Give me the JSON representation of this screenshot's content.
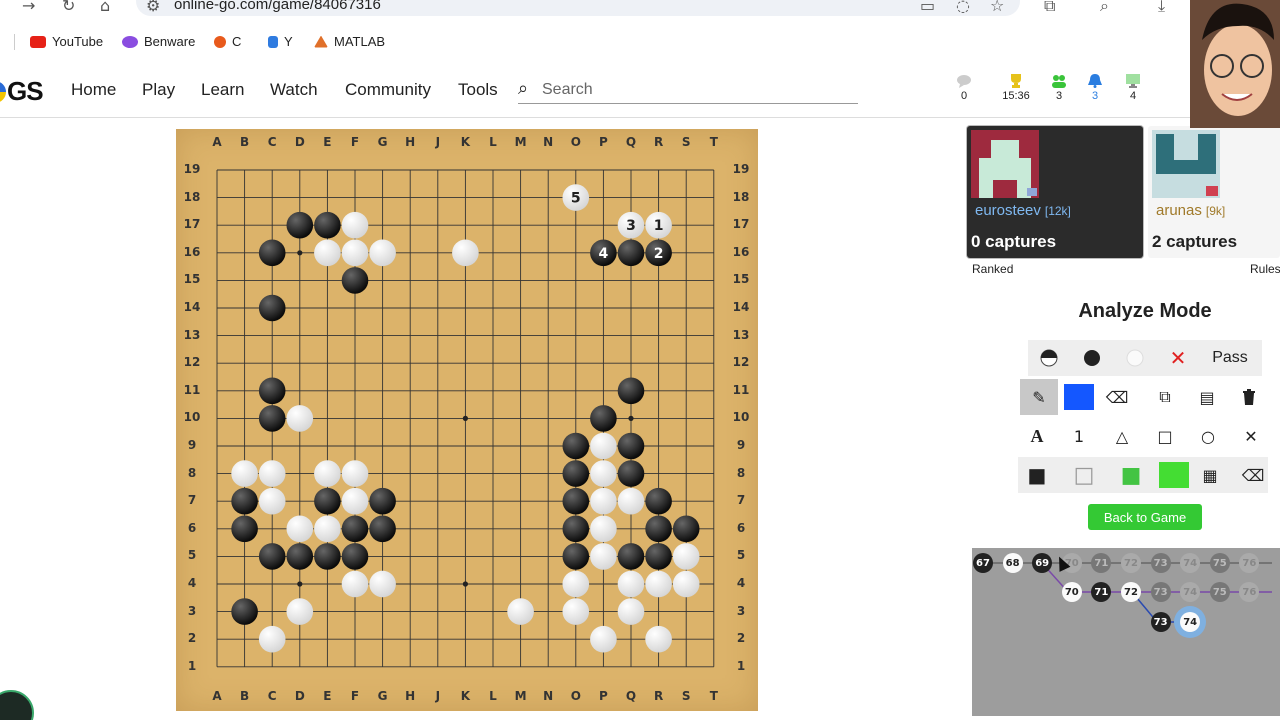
{
  "browser": {
    "url": "online-go.com/game/84067316",
    "bookmarks": [
      {
        "label": "YouTube",
        "color": "#e62117"
      },
      {
        "label": "Benware",
        "color": "#8a4de0"
      },
      {
        "label": "C",
        "color": "#e85a1c"
      },
      {
        "label": "Y",
        "color": "#2f7be0"
      },
      {
        "label": "MATLAB",
        "color": "#e0702a"
      }
    ]
  },
  "nav": {
    "logo": "GS",
    "items": [
      "Home",
      "Play",
      "Learn",
      "Watch",
      "Community",
      "Tools"
    ],
    "search_placeholder": "Search",
    "stats": [
      {
        "icon": "chat-bubble-icon",
        "value": "0",
        "color": "#cccccc"
      },
      {
        "icon": "trophy-icon",
        "value": "15:36",
        "color": "#e6c21a"
      },
      {
        "icon": "group-icon",
        "value": "3",
        "color": "#3ac43a"
      },
      {
        "icon": "bell-icon",
        "value": "3",
        "color": "#2a7de0"
      },
      {
        "icon": "monitor-icon",
        "value": "4",
        "color": "#a0e0a0"
      }
    ]
  },
  "board": {
    "columns": [
      "A",
      "B",
      "C",
      "D",
      "E",
      "F",
      "G",
      "H",
      "J",
      "K",
      "L",
      "M",
      "N",
      "O",
      "P",
      "Q",
      "R",
      "S",
      "T"
    ],
    "rows": [
      "19",
      "18",
      "17",
      "16",
      "15",
      "14",
      "13",
      "12",
      "11",
      "10",
      "9",
      "8",
      "7",
      "6",
      "5",
      "4",
      "3",
      "2",
      "1"
    ],
    "black_stones": [
      "D17",
      "E17",
      "C16",
      "F15",
      "C14",
      "C11",
      "C10",
      "Q11",
      "P10",
      "O9",
      "Q9",
      "O8",
      "Q8",
      "B7",
      "E7",
      "G7",
      "O7",
      "R7",
      "B6",
      "F6",
      "G6",
      "O6",
      "R6",
      "S6",
      "C5",
      "D5",
      "E5",
      "F5",
      "O5",
      "Q5",
      "R5",
      "B3",
      "P16",
      "Q16",
      "R16"
    ],
    "white_stones": [
      "F17",
      "E16",
      "F16",
      "G16",
      "K16",
      "D10",
      "P9",
      "B8",
      "C8",
      "E8",
      "F8",
      "P8",
      "C7",
      "F7",
      "P7",
      "Q7",
      "D6",
      "E6",
      "P6",
      "P5",
      "S5",
      "F4",
      "G4",
      "O4",
      "Q4",
      "R4",
      "S4",
      "D3",
      "M3",
      "O3",
      "Q3",
      "C2",
      "P2",
      "R2",
      "O18",
      "Q17",
      "R17"
    ],
    "labels": [
      {
        "point": "O18",
        "text": "5"
      },
      {
        "point": "Q17",
        "text": "3"
      },
      {
        "point": "R17",
        "text": "1"
      },
      {
        "point": "P16",
        "text": "4"
      },
      {
        "point": "R16",
        "text": "2"
      }
    ],
    "star_points": [
      "D16",
      "K16",
      "Q16",
      "D10",
      "K10",
      "Q10",
      "D4",
      "K4",
      "Q4"
    ]
  },
  "players": [
    {
      "name": "eurosteev",
      "rank": "[12k]",
      "captures": "0 captures",
      "note": "Ranked"
    },
    {
      "name": "arunas",
      "rank": "[9k]",
      "captures": "2 captures",
      "note": "Rules"
    }
  ],
  "analyze": {
    "title": "Analyze Mode",
    "row1": [
      {
        "name": "alternate-stone-icon",
        "glyph": "◐"
      },
      {
        "name": "black-stone-icon",
        "glyph": "●"
      },
      {
        "name": "white-stone-icon",
        "glyph": "●"
      },
      {
        "name": "delete-x-icon",
        "glyph": "✕"
      },
      {
        "name": "pass-button",
        "glyph": "Pass"
      }
    ],
    "row2": [
      {
        "name": "pen-icon",
        "glyph": "✎"
      },
      {
        "name": "color-swatch-blue",
        "glyph": ""
      },
      {
        "name": "eraser-icon",
        "glyph": "⌫"
      },
      {
        "name": "copy-icon",
        "glyph": "⧉"
      },
      {
        "name": "paste-icon",
        "glyph": "▤"
      },
      {
        "name": "trash-icon",
        "glyph": "🗑"
      }
    ],
    "row3": [
      {
        "name": "letter-label-icon",
        "glyph": "A"
      },
      {
        "name": "number-label-icon",
        "glyph": "1"
      },
      {
        "name": "triangle-icon",
        "glyph": "△"
      },
      {
        "name": "square-icon",
        "glyph": "□"
      },
      {
        "name": "circle-icon",
        "glyph": "○"
      },
      {
        "name": "cross-icon",
        "glyph": "✕"
      }
    ],
    "row4": [
      {
        "name": "black-square-icon",
        "glyph": "■"
      },
      {
        "name": "white-square-icon",
        "glyph": "□"
      },
      {
        "name": "green-square-icon",
        "glyph": "■"
      },
      {
        "name": "green-swatch",
        "glyph": ""
      },
      {
        "name": "calculator-icon",
        "glyph": "▦"
      },
      {
        "name": "clear-icon",
        "glyph": "⌫"
      }
    ],
    "back_label": "Back to Game"
  },
  "move_tree": {
    "main": [
      {
        "n": "67",
        "c": "b"
      },
      {
        "n": "68",
        "c": "w"
      },
      {
        "n": "69",
        "c": "b"
      },
      {
        "n": "70",
        "c": "gw"
      },
      {
        "n": "71",
        "c": "gb"
      },
      {
        "n": "72",
        "c": "gw"
      },
      {
        "n": "73",
        "c": "gb"
      },
      {
        "n": "74",
        "c": "gw"
      },
      {
        "n": "75",
        "c": "gb"
      },
      {
        "n": "76",
        "c": "gw"
      }
    ],
    "branch1": [
      {
        "n": "70",
        "c": "w"
      },
      {
        "n": "71",
        "c": "b"
      },
      {
        "n": "72",
        "c": "w"
      },
      {
        "n": "73",
        "c": "gb"
      },
      {
        "n": "74",
        "c": "gw"
      },
      {
        "n": "75",
        "c": "gb"
      },
      {
        "n": "76",
        "c": "gw"
      }
    ],
    "branch2": [
      {
        "n": "73",
        "c": "b"
      },
      {
        "n": "74",
        "c": "w"
      }
    ]
  }
}
